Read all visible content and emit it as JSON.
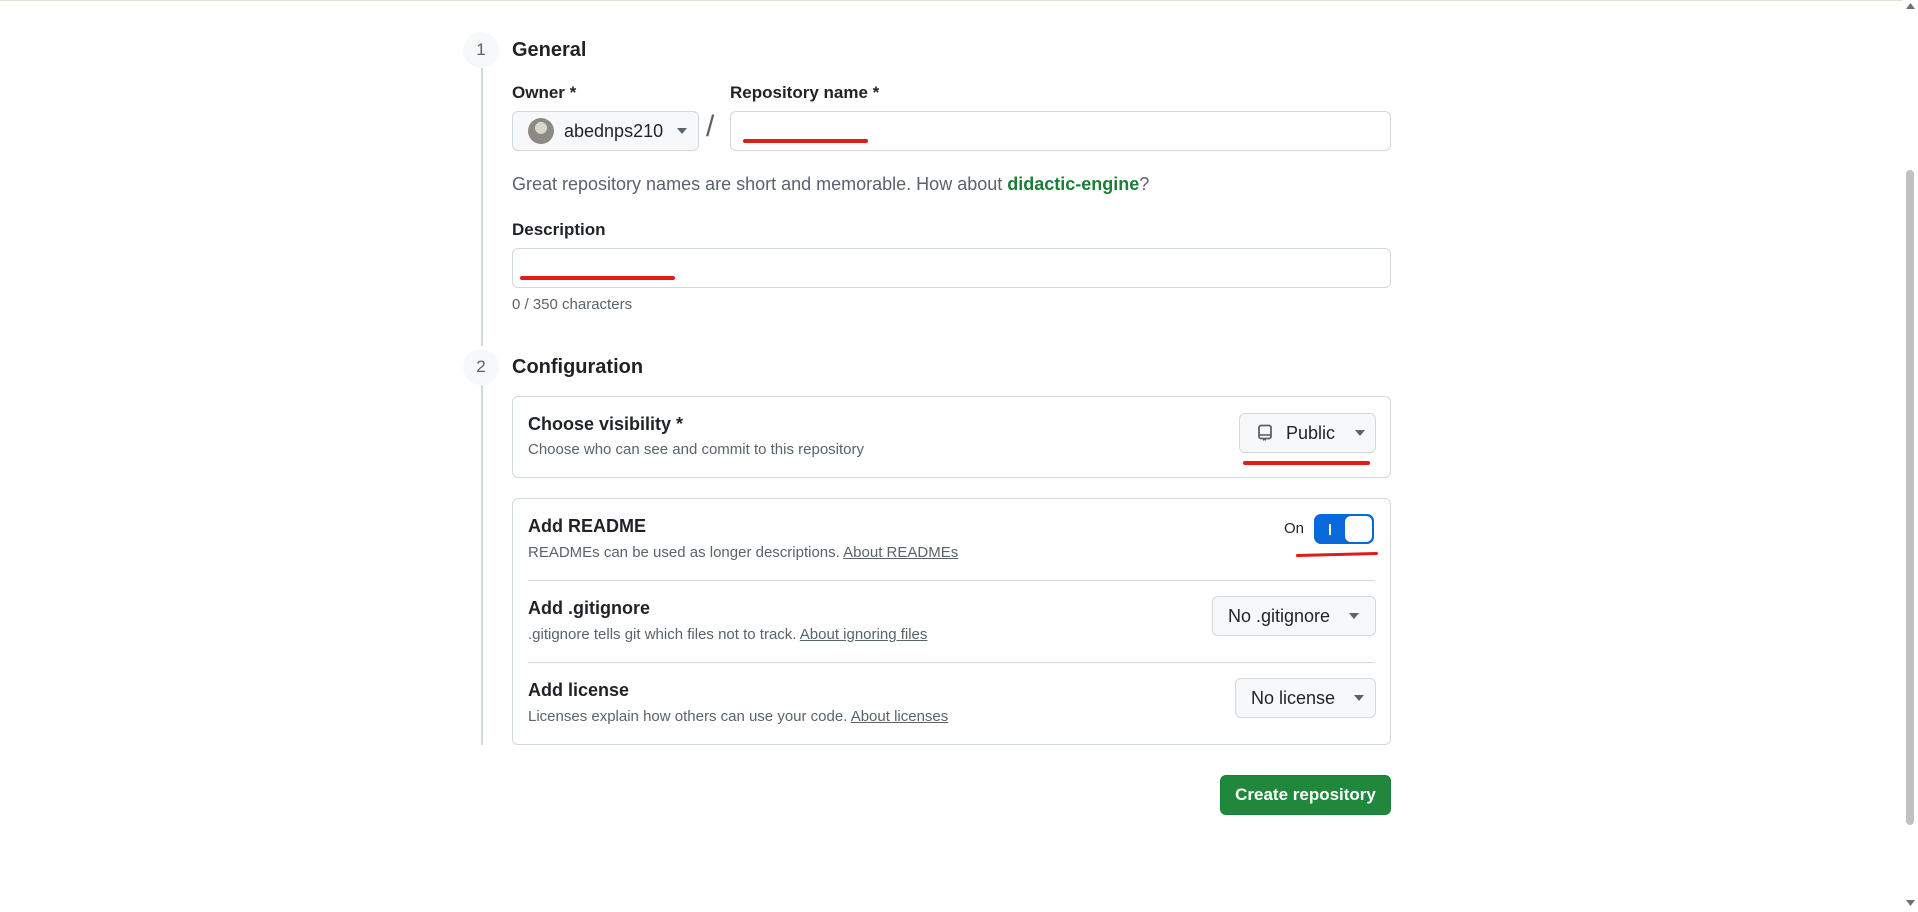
{
  "steps": {
    "general": {
      "number": "1",
      "title": "General"
    },
    "configuration": {
      "number": "2",
      "title": "Configuration"
    }
  },
  "owner": {
    "label": "Owner *",
    "value": "abednps210"
  },
  "separator": "/",
  "repo_name": {
    "label": "Repository name *",
    "value": "",
    "placeholder": ""
  },
  "suggestion": {
    "prefix": "Great repository names are short and memorable. How about ",
    "name": "didactic-engine",
    "suffix": "?"
  },
  "description": {
    "label": "Description",
    "value": "",
    "counter": "0 / 350 characters"
  },
  "visibility": {
    "title": "Choose visibility *",
    "desc": "Choose who can see and commit to this repository",
    "value": "Public",
    "icon": "repo-icon"
  },
  "readme": {
    "title": "Add README",
    "desc": "READMEs can be used as longer descriptions. ",
    "link": "About READMEs",
    "toggle_label": "On",
    "toggle_on": true
  },
  "gitignore": {
    "title": "Add .gitignore",
    "desc": ".gitignore tells git which files not to track. ",
    "link": "About ignoring files",
    "value": "No .gitignore"
  },
  "license": {
    "title": "Add license",
    "desc": "Licenses explain how others can use your code. ",
    "link": "About licenses",
    "value": "No license"
  },
  "submit": {
    "label": "Create repository"
  },
  "colors": {
    "accent_green": "#1f883d",
    "link_green": "#1a7f37",
    "toggle_blue": "#0969da",
    "annotation_red": "#e01b1b"
  }
}
